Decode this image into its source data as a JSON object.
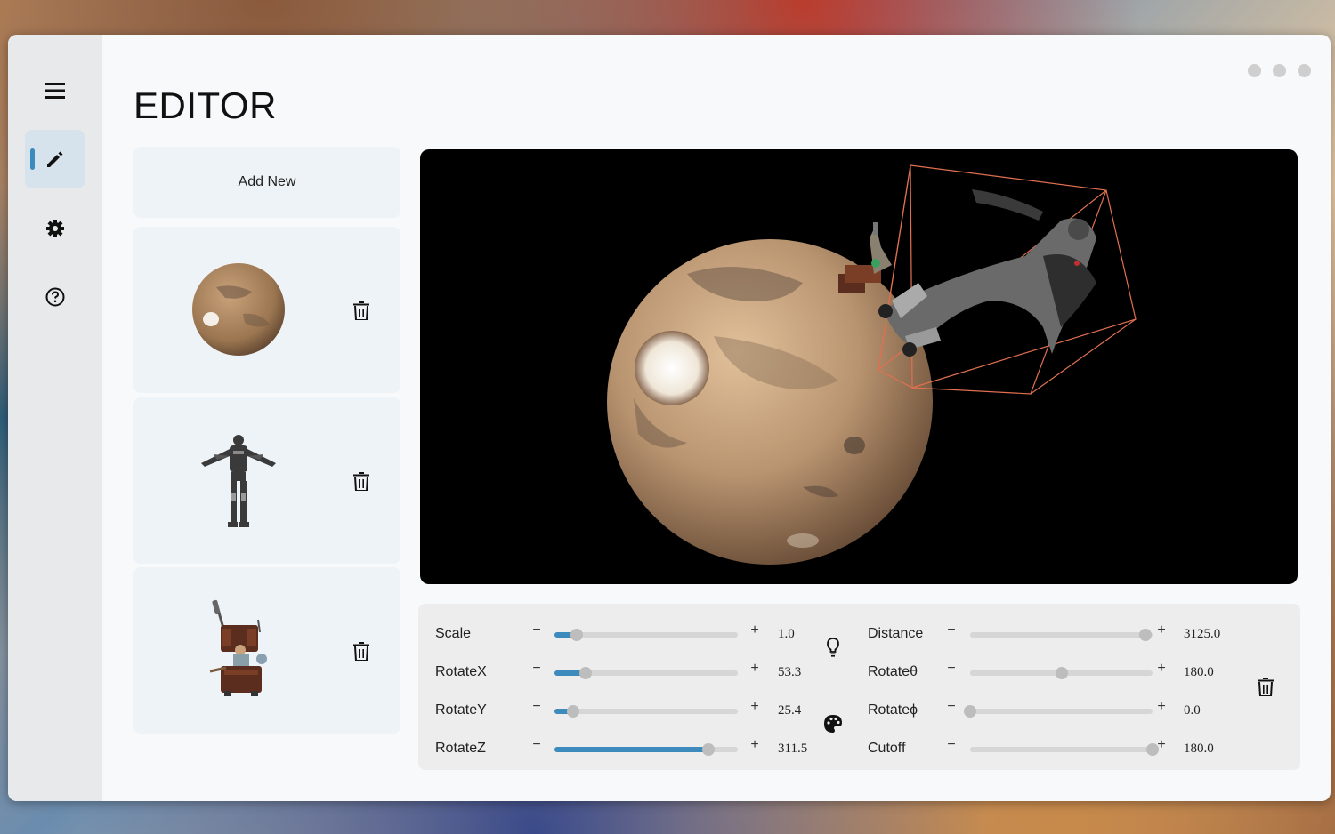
{
  "app": {
    "title": "EDITOR"
  },
  "sidebar": {
    "items": [
      {
        "icon": "menu-icon"
      },
      {
        "icon": "pencil-icon",
        "active": true
      },
      {
        "icon": "gear-icon"
      },
      {
        "icon": "help-icon"
      }
    ]
  },
  "objects": {
    "add_label": "Add New",
    "items": [
      {
        "name": "mars-planet",
        "icon": "planet-thumbnail"
      },
      {
        "name": "armored-robot",
        "icon": "robot-thumbnail"
      },
      {
        "name": "explorer-figure",
        "icon": "explorer-thumbnail"
      }
    ]
  },
  "controls": {
    "left": [
      {
        "label": "Scale",
        "value": "1.0",
        "fraction": 0.12
      },
      {
        "label": "RotateX",
        "value": "53.3",
        "fraction": 0.17
      },
      {
        "label": "RotateY",
        "value": "25.4",
        "fraction": 0.1
      },
      {
        "label": "RotateZ",
        "value": "311.5",
        "fraction": 0.84
      }
    ],
    "right": [
      {
        "label": "Distance",
        "value": "3125.0",
        "fraction": 0.96
      },
      {
        "label": "Rotateθ",
        "value": "180.0",
        "fraction": 0.5
      },
      {
        "label": "Rotateϕ",
        "value": "0.0",
        "fraction": 0.0
      },
      {
        "label": "Cutoff",
        "value": "180.0",
        "fraction": 1.0
      }
    ],
    "minus_label": "−",
    "plus_label": "+"
  },
  "colors": {
    "accent": "#3d8bbd",
    "viewport_bg": "#000000",
    "bounding_box": "#e07050"
  }
}
